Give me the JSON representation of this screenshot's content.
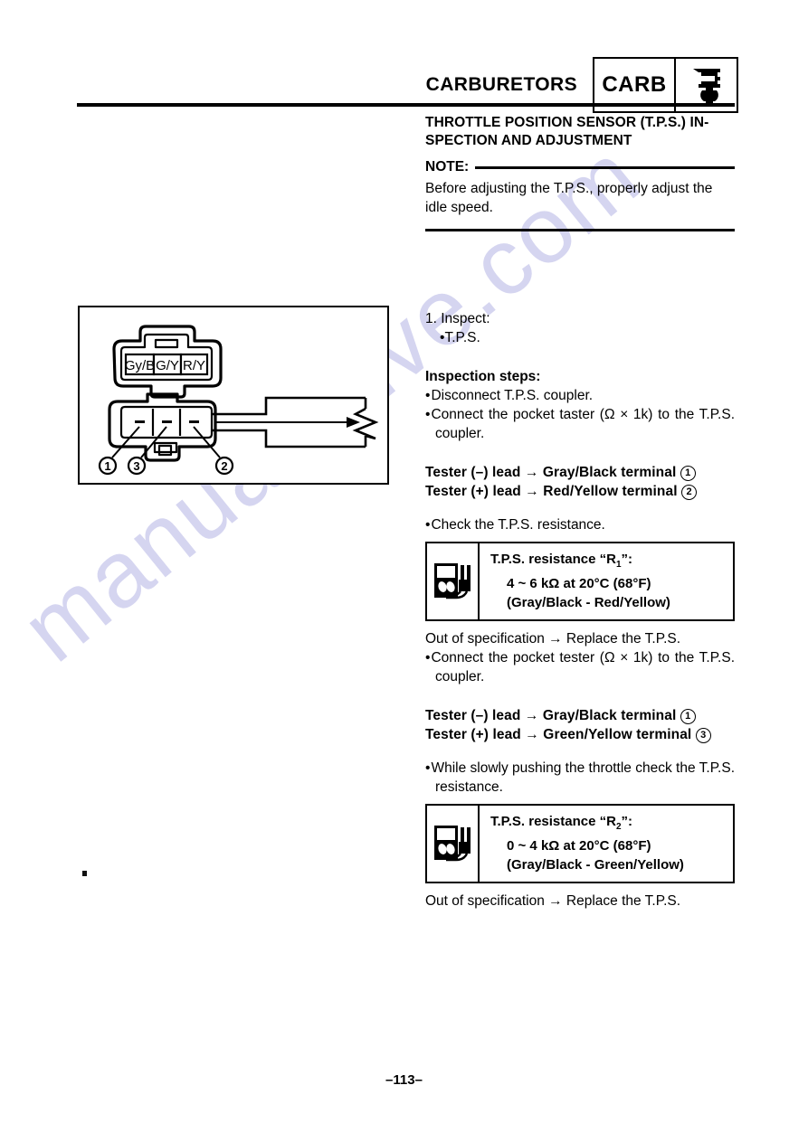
{
  "page": {
    "number": "–113–",
    "watermark": "manualshive.com"
  },
  "header": {
    "title": "CARBURETORS",
    "badge_label": "CARB",
    "badge_icon": "carburetor-icon"
  },
  "section": {
    "title_line1": "THROTTLE POSITION SENSOR (T.P.S.) IN-",
    "title_line2": "SPECTION AND ADJUSTMENT",
    "note_label": "NOTE:",
    "note_body": "Before adjusting the T.P.S., properly adjust the idle speed."
  },
  "procedure": {
    "step1_number": "1.",
    "step1_label": "Inspect:",
    "step1_item": "T.P.S.",
    "steps_heading": "Inspection steps:",
    "bullet_disconnect": "Disconnect T.P.S. coupler.",
    "bullet_connect_1": "Connect the pocket taster (Ω × 1k) to the T.P.S. coupler.",
    "lead_neg_1": "Tester (–) lead → Gray/Black terminal",
    "lead_neg_1_callout": "1",
    "lead_pos_1": "Tester (+) lead → Red/Yellow terminal",
    "lead_pos_1_callout": "2",
    "bullet_check": "Check the T.P.S. resistance.",
    "out_of_spec_1": "Out of specification → Replace the T.P.S.",
    "bullet_connect_2": "Connect the pocket tester (Ω × 1k) to the T.P.S. coupler.",
    "lead_neg_2": "Tester (–) lead → Gray/Black terminal",
    "lead_neg_2_callout": "1",
    "lead_pos_2": "Tester (+) lead → Green/Yellow terminal",
    "lead_pos_2_callout": "3",
    "bullet_while": "While slowly pushing the throttle check the T.P.S. resistance.",
    "out_of_spec_2": "Out of specification → Replace the T.P.S."
  },
  "spec_box_1": {
    "icon": "pocket-tester-icon",
    "line1_pre": "T.P.S. resistance “R",
    "line1_sub": "1",
    "line1_post": "”:",
    "line2": "4 ~ 6 kΩ at 20°C (68°F)",
    "line3": "(Gray/Black - Red/Yellow)"
  },
  "spec_box_2": {
    "icon": "pocket-tester-icon",
    "line1_pre": "T.P.S. resistance “R",
    "line1_sub": "2",
    "line1_post": "”:",
    "line2": "0 ~ 4 kΩ at 20°C (68°F)",
    "line3": "(Gray/Black - Green/Yellow)"
  },
  "diagram": {
    "coupler_terminals": [
      "Gy/B",
      "G/Y",
      "R/Y"
    ],
    "callouts": [
      {
        "id": "1",
        "pin": "left"
      },
      {
        "id": "3",
        "pin": "middle"
      },
      {
        "id": "2",
        "pin": "right"
      }
    ],
    "circuit_symbol": "potentiometer"
  }
}
